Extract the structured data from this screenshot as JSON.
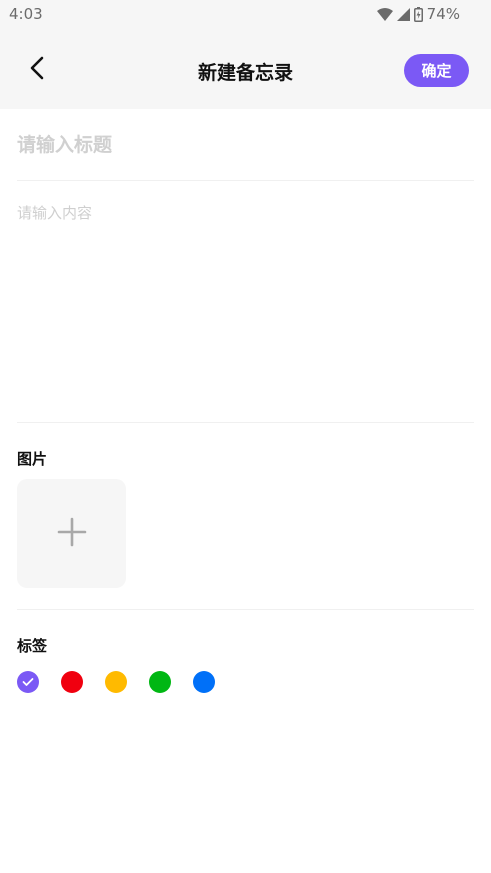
{
  "status_bar": {
    "time": "4:03",
    "battery": "74%",
    "icons": [
      "wifi-icon",
      "signal-icon",
      "battery-icon"
    ]
  },
  "header": {
    "title": "新建备忘录",
    "back_icon": "chevron-left-icon",
    "confirm_label": "确定"
  },
  "form": {
    "title_placeholder": "请输入标题",
    "title_value": "",
    "content_placeholder": "请输入内容",
    "content_value": ""
  },
  "images": {
    "label": "图片",
    "add_icon": "plus-icon"
  },
  "tags": {
    "label": "标签",
    "selected_index": 0,
    "colors": [
      "#7b59f5",
      "#f0000f",
      "#ffba00",
      "#00b713",
      "#0070f8"
    ]
  },
  "colors": {
    "accent": "#7b59f5",
    "header_bg": "#f6f6f6"
  }
}
